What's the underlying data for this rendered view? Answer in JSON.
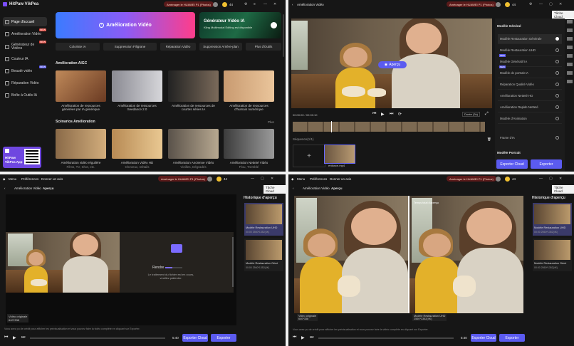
{
  "app": {
    "name": "HitPaw VikPea",
    "promo": "Aménager le HUAWEI P1 (Photos)",
    "credits": "44",
    "task_list": "Tâche Cloud"
  },
  "menu": {
    "menu": "Menu",
    "preferences": "Préférences",
    "feedback": "Donner un avis"
  },
  "home": {
    "sidebar": [
      {
        "label": "Page d'accueil",
        "icon": "home-icon"
      },
      {
        "label": "Amélioration Vidéo",
        "icon": "video-icon",
        "badge": "NEW"
      },
      {
        "label": "Générateur de Vidéos",
        "icon": "generate-icon",
        "badge": "NEW"
      },
      {
        "label": "Couleur IA",
        "icon": "palette-icon"
      },
      {
        "label": "Beauté vidéo",
        "icon": "beauty-icon",
        "badge": "NEW"
      },
      {
        "label": "Réparation Vidéo",
        "icon": "repair-icon"
      },
      {
        "label": "Boîte à Outils IA",
        "icon": "toolbox-icon"
      }
    ],
    "app_card": {
      "line1": "HitPaw",
      "line2": "VikPea App"
    },
    "hero_main": "Amélioration Vidéo",
    "hero_side_title": "Générateur Vidéo IA",
    "hero_side_sub": "Kling Multimodal Editing est disponible",
    "tools": [
      "Coloriste IA",
      "Suppression Filigrane",
      "Réparation Vidéo",
      "Suppression Arrière-plan",
      "Plus d'Outils"
    ],
    "section_aigc": "Amélioration AIGC",
    "aigc_cards": [
      "Amélioration de ressources générées par IA générique",
      "Amélioration de ressources Seedance 2.0",
      "Amélioration de ressources de courtes séries IA",
      "Amélioration de ressources d'humain numérique"
    ],
    "section_scenarios": "Scénarios Amélioration",
    "more": "Plus",
    "scenario_cards": [
      {
        "title": "Amélioration vidéo régulière",
        "sub": "Films, TV, Shot, etc."
      },
      {
        "title": "Amélioration Vidéo HD",
        "sub": "Cheveux, Détails"
      },
      {
        "title": "Amélioration Ancienne Vidéo",
        "sub": "Vieilles, Dégradés"
      },
      {
        "title": "Amélioration Netteté Vidéo",
        "sub": "Flou, Tremblé"
      }
    ]
  },
  "editor": {
    "title": "Amélioration Vidéo",
    "preview_btn": "Aperçu",
    "timecode": "00:00:00 / 00:00:10",
    "ratio": "Durée (3s)",
    "sequence_label": "Séquence(1/1)",
    "clip_name": "enfance.mp4",
    "panel": {
      "general_section": "Modèle Général",
      "models": [
        {
          "name": "Modèle Restauration Générale",
          "selected": true
        },
        {
          "name": "Modèle Restauration UHD"
        },
        {
          "name": "Modèle Génératif IA",
          "badge": "NEW"
        },
        {
          "name": "Modèle de portrait IA",
          "badge": "NEW"
        },
        {
          "name": "Réparation Qualité Vidéo"
        },
        {
          "name": "Amélioration Netteté HD"
        },
        {
          "name": "Amélioration Rapide Netteté"
        },
        {
          "name": "Modèle d'Animation"
        }
      ],
      "fps_label": "Frame d'IA",
      "portrait_section": "Modèle Portrait",
      "export_cloud": "Exporter Cloud",
      "export": "Exporter"
    }
  },
  "preview": {
    "breadcrumb_root": "Amélioration Vidéo",
    "breadcrumb_current": "Aperçu",
    "history_title": "Historique d'aperçu",
    "render_label": "Rendre",
    "render_message": "Le traitement du fichier est en cours, veuillez patienter.",
    "orig_label": "Vidéo originale",
    "orig_res": "640*338",
    "history_items": [
      {
        "name": "Modèle Restauration UHD",
        "meta": "00:00  2560*1352(4K)"
      },
      {
        "name": "Modèle Restauration Géné",
        "meta": "00:00  2560*1352(4K)"
      }
    ],
    "compare_note": "Temps total d'aperçu",
    "result_label": "Modèle Restauration UHD",
    "result_res": "2560*1352(4K)",
    "bottom_hint": "Vous avez pu de crédit pour afficher les prévisualisation et vous pouvez faire la vidéo complète en cliquant sur Exporter.",
    "time_end": "5:40",
    "export_cloud": "Exporter Cloud",
    "export": "Exporter"
  }
}
